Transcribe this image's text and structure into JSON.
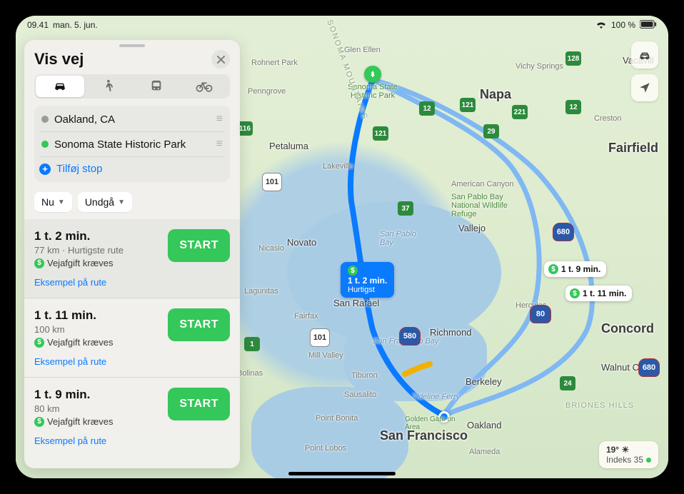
{
  "status": {
    "time": "09.41",
    "date": "man. 5. jun.",
    "battery": "100 %"
  },
  "panel": {
    "title": "Vis vej",
    "modes": {
      "car": "car",
      "walk": "walk",
      "transit": "transit",
      "bike": "bike"
    },
    "from": "Oakland, CA",
    "to": "Sonoma State Historic Park",
    "add_stop": "Tilføj stop",
    "now": "Nu",
    "avoid": "Undgå"
  },
  "routes": [
    {
      "time": "1 t. 2 min.",
      "sub": "77 km · Hurtigste rute",
      "toll": "Vejafgift kræves",
      "preview": "Eksempel på rute",
      "start": "START"
    },
    {
      "time": "1 t. 11 min.",
      "sub": "100 km",
      "toll": "Vejafgift kræves",
      "preview": "Eksempel på rute",
      "start": "START"
    },
    {
      "time": "1 t. 9 min.",
      "sub": "80 km",
      "toll": "Vejafgift kræves",
      "preview": "Eksempel på rute",
      "start": "START"
    }
  ],
  "map_badges": {
    "primary": {
      "time": "1 t. 2 min.",
      "tag": "Hurtigst"
    },
    "alt1": "1 t. 9 min.",
    "alt2": "1 t. 11 min."
  },
  "cities": {
    "sanfrancisco": "San Francisco",
    "oakland": "Oakland",
    "berkeley": "Berkeley",
    "richmond": "Richmond",
    "sanrafael": "San Rafael",
    "novato": "Novato",
    "petaluma": "Petaluma",
    "napa": "Napa",
    "vallejo": "Vallejo",
    "concord": "Concord",
    "walnutcreek": "Walnut Creek",
    "fairfield": "Fairfield",
    "vacaville": "Vacavill",
    "hercules": "Hercules",
    "americancanyon": "American Canyon",
    "alameda": "Alameda",
    "sausalito": "Sausalito",
    "tiburon": "Tiburon",
    "millvalley": "Mill Valley",
    "fairfax": "Fairfax",
    "lagunitas": "Lagunitas",
    "nicasio": "Nicasio",
    "bolinas": "Bolinas",
    "lakeville": "Lakeville",
    "penngrove": "Penngrove",
    "rohnertpark": "Rohnert Park",
    "glenellen": "Glen Ellen",
    "vichysprings": "Vichy Springs",
    "creston": "Creston",
    "pointlobos": "Point Lobos",
    "pointbonita": "Point Bonita",
    "sonoma_mtns": "SONOMA MOUNTAINS",
    "sanpablobay": "San Pablo Bay",
    "sfbay": "San Francisco Bay",
    "tidelineferry": "Tideline Ferry",
    "briones": "BRIONES HILLS",
    "sonomapark": "Sonoma State Historic Park",
    "napawildlife": "San Pablo Bay National Wildlife Refuge",
    "goldengate": "Golden Gate on Area"
  },
  "shields": {
    "i80": "80",
    "i580": "580",
    "i680": "680",
    "us101": "101",
    "ca1": "1",
    "ca12": "12",
    "ca24": "24",
    "ca29": "29",
    "ca37": "37",
    "ca121": "121",
    "ca128": "128",
    "ca221": "221",
    "ca116": "116"
  },
  "weather": {
    "temp": "19°",
    "index": "Indeks 35"
  }
}
